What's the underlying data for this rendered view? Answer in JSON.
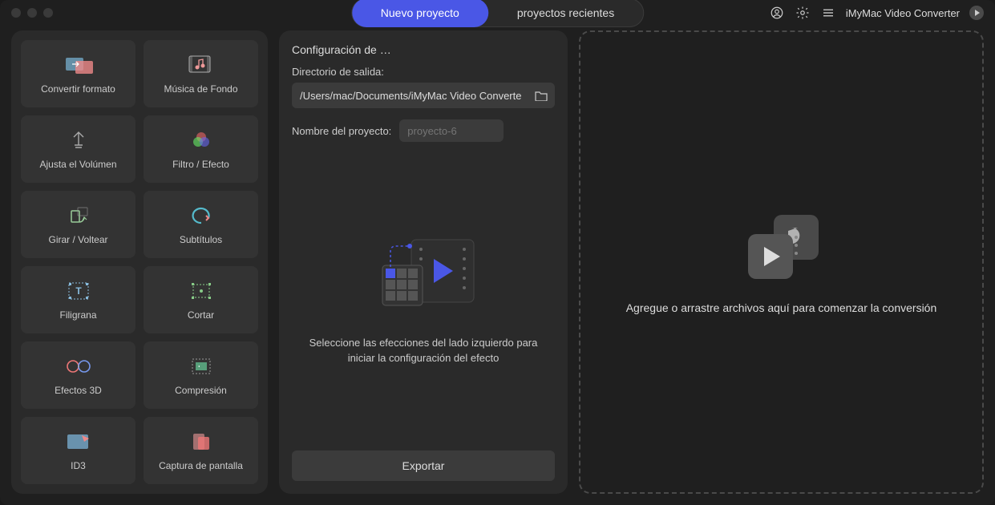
{
  "header": {
    "tabs": {
      "new": "Nuevo proyecto",
      "recent": "proyectos recientes"
    },
    "app_title": "iMyMac Video Converter"
  },
  "sidebar": {
    "tools": [
      {
        "label": "Convertir formato",
        "icon": "convert-format-icon"
      },
      {
        "label": "Música de Fondo",
        "icon": "background-music-icon"
      },
      {
        "label": "Ajusta el Volúmen",
        "icon": "adjust-volume-icon"
      },
      {
        "label": "Filtro / Efecto",
        "icon": "filter-effect-icon"
      },
      {
        "label": "Girar / Voltear",
        "icon": "rotate-flip-icon"
      },
      {
        "label": "Subtítulos",
        "icon": "subtitles-icon"
      },
      {
        "label": "Filigrana",
        "icon": "watermark-icon"
      },
      {
        "label": "Cortar",
        "icon": "crop-icon"
      },
      {
        "label": "Efectos 3D",
        "icon": "3d-effects-icon"
      },
      {
        "label": "Compresión",
        "icon": "compression-icon"
      },
      {
        "label": "ID3",
        "icon": "id3-icon"
      },
      {
        "label": "Captura de pantalla",
        "icon": "screenshot-icon"
      }
    ]
  },
  "mid": {
    "title": "Configuración de …",
    "output_dir_label": "Directorio de salida:",
    "output_dir_value": "/Users/mac/Documents/iMyMac Video Converte",
    "project_name_label": "Nombre del proyecto:",
    "project_name_placeholder": "proyecto-6",
    "hint": "Seleccione las efecciones del lado izquierdo para iniciar la configuración del efecto",
    "export_label": "Exportar"
  },
  "drop": {
    "hint": "Agregue o arrastre archivos aquí para comenzar la conversión"
  }
}
